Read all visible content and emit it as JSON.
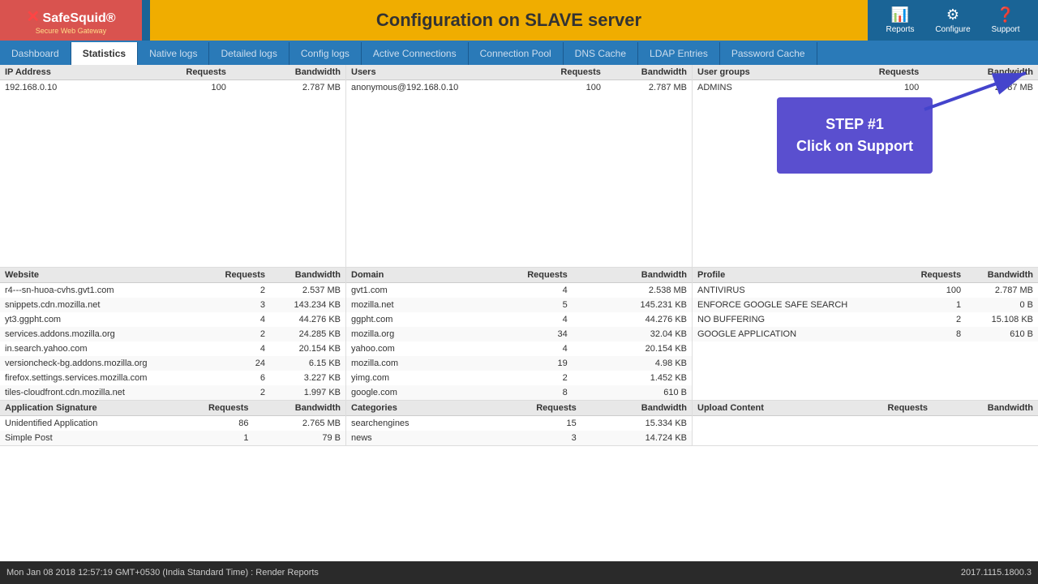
{
  "header": {
    "logo_title": "SafeSquid®",
    "logo_subtitle": "Secure Web Gateway",
    "config_banner": "Configuration on SLAVE server",
    "icons": [
      {
        "name": "reports",
        "label": "Reports",
        "symbol": "📊"
      },
      {
        "name": "configure",
        "label": "Configure",
        "symbol": "⚙"
      },
      {
        "name": "support",
        "label": "Support",
        "symbol": "?"
      }
    ]
  },
  "nav": {
    "tabs": [
      {
        "label": "Dashboard",
        "active": false
      },
      {
        "label": "Statistics",
        "active": true
      },
      {
        "label": "Native logs",
        "active": false
      },
      {
        "label": "Detailed logs",
        "active": false
      },
      {
        "label": "Config logs",
        "active": false
      },
      {
        "label": "Active Connections",
        "active": false
      },
      {
        "label": "Connection Pool",
        "active": false
      },
      {
        "label": "DNS Cache",
        "active": false
      },
      {
        "label": "LDAP Entries",
        "active": false
      },
      {
        "label": "Password Cache",
        "active": false
      }
    ]
  },
  "tooltip": {
    "step": "STEP #1",
    "action": "Click on Support"
  },
  "top_tables": {
    "ip_table": {
      "headers": [
        "IP Address",
        "Requests",
        "Bandwidth"
      ],
      "rows": [
        {
          "ip": "192.168.0.10",
          "requests": "100",
          "bandwidth": "2.787 MB"
        }
      ]
    },
    "users_table": {
      "headers": [
        "Users",
        "Requests",
        "Bandwidth"
      ],
      "rows": [
        {
          "user": "anonymous@192.168.0.10",
          "requests": "100",
          "bandwidth": "2.787 MB"
        }
      ]
    },
    "usergroups_table": {
      "headers": [
        "User groups",
        "Requests",
        "Bandwidth"
      ],
      "rows": [
        {
          "group": "ADMINS",
          "requests": "100",
          "bandwidth": "2.787 MB"
        }
      ]
    }
  },
  "website_table": {
    "headers": [
      "Website",
      "Requests",
      "Bandwidth"
    ],
    "rows": [
      {
        "site": "r4---sn-huoa-cvhs.gvt1.com",
        "requests": "2",
        "bandwidth": "2.537 MB"
      },
      {
        "site": "snippets.cdn.mozilla.net",
        "requests": "3",
        "bandwidth": "143.234 KB"
      },
      {
        "site": "yt3.ggpht.com",
        "requests": "4",
        "bandwidth": "44.276 KB"
      },
      {
        "site": "services.addons.mozilla.org",
        "requests": "2",
        "bandwidth": "24.285 KB"
      },
      {
        "site": "in.search.yahoo.com",
        "requests": "4",
        "bandwidth": "20.154 KB"
      },
      {
        "site": "versioncheck-bg.addons.mozilla.org",
        "requests": "24",
        "bandwidth": "6.15 KB"
      },
      {
        "site": "firefox.settings.services.mozilla.com",
        "requests": "6",
        "bandwidth": "3.227 KB"
      },
      {
        "site": "tiles-cloudfront.cdn.mozilla.net",
        "requests": "2",
        "bandwidth": "1.997 KB"
      }
    ]
  },
  "domain_table": {
    "headers": [
      "Domain",
      "Requests",
      "Bandwidth"
    ],
    "rows": [
      {
        "domain": "gvt1.com",
        "requests": "4",
        "bandwidth": "2.538 MB"
      },
      {
        "domain": "mozilla.net",
        "requests": "5",
        "bandwidth": "145.231 KB"
      },
      {
        "domain": "ggpht.com",
        "requests": "4",
        "bandwidth": "44.276 KB"
      },
      {
        "domain": "mozilla.org",
        "requests": "34",
        "bandwidth": "32.04 KB"
      },
      {
        "domain": "yahoo.com",
        "requests": "4",
        "bandwidth": "20.154 KB"
      },
      {
        "domain": "mozilla.com",
        "requests": "19",
        "bandwidth": "4.98 KB"
      },
      {
        "domain": "yimg.com",
        "requests": "2",
        "bandwidth": "1.452 KB"
      },
      {
        "domain": "google.com",
        "requests": "8",
        "bandwidth": "610 B"
      }
    ]
  },
  "profile_table": {
    "headers": [
      "Profile",
      "Requests",
      "Bandwidth"
    ],
    "rows": [
      {
        "profile": "ANTIVIRUS",
        "requests": "100",
        "bandwidth": "2.787 MB"
      },
      {
        "profile": "ENFORCE GOOGLE SAFE SEARCH",
        "requests": "1",
        "bandwidth": "0 B"
      },
      {
        "profile": "NO BUFFERING",
        "requests": "2",
        "bandwidth": "15.108 KB"
      },
      {
        "profile": "GOOGLE APPLICATION",
        "requests": "8",
        "bandwidth": "610 B"
      }
    ]
  },
  "appsig_table": {
    "headers": [
      "Application Signature",
      "Requests",
      "Bandwidth"
    ],
    "rows": [
      {
        "sig": "Unidentified Application",
        "requests": "86",
        "bandwidth": "2.765 MB"
      },
      {
        "sig": "Simple Post",
        "requests": "1",
        "bandwidth": "79 B"
      }
    ]
  },
  "categories_table": {
    "headers": [
      "Categories",
      "Requests",
      "Bandwidth"
    ],
    "rows": [
      {
        "cat": "searchengines",
        "requests": "15",
        "bandwidth": "15.334 KB"
      },
      {
        "cat": "news",
        "requests": "3",
        "bandwidth": "14.724 KB"
      }
    ]
  },
  "upload_table": {
    "headers": [
      "Upload Content",
      "Requests",
      "Bandwidth"
    ],
    "rows": []
  },
  "status_bar": {
    "left": "Mon Jan 08 2018 12:57:19 GMT+0530 (India Standard Time) : Render Reports",
    "right": "2017.1115.1800.3"
  }
}
